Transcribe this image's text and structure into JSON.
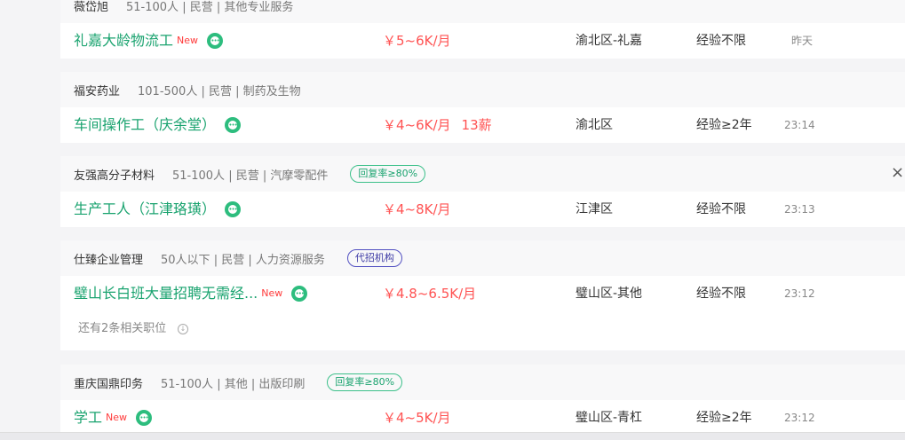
{
  "jobs": [
    {
      "company": "薇岱旭",
      "meta": "51-100人 | 民营 | 其他专业服务",
      "title": "礼嘉大龄物流工",
      "new": "New",
      "salary": "￥5~6K/月",
      "location": "渝北区-礼嘉",
      "experience": "经验不限",
      "time": "昨天"
    },
    {
      "company": "福安药业",
      "meta": "101-500人 | 民营 | 制药及生物",
      "title": "车间操作工（庆余堂）",
      "salary": "￥4~6K/月",
      "salary_extra": "13薪",
      "location": "渝北区",
      "experience": "经验≥2年",
      "time": "23:14"
    },
    {
      "company": "友强高分子材料",
      "meta": "51-100人 | 民营 | 汽摩零配件",
      "tag": "回复率≥80%",
      "title": "生产工人（江津珞璜）",
      "salary": "￥4~8K/月",
      "location": "江津区",
      "experience": "经验不限",
      "time": "23:13"
    },
    {
      "company": "仕臻企业管理",
      "meta": "50人以下 | 民营 | 人力资源服务",
      "tag": "代招机构",
      "title": "璧山长白班大量招聘无需经...",
      "new": "New",
      "salary": "￥4.8~6.5K/月",
      "location": "璧山区-其他",
      "experience": "经验不限",
      "time": "23:12",
      "more": "还有2条相关职位"
    },
    {
      "company": "重庆国鼎印务",
      "meta": "51-100人 | 其他 | 出版印刷",
      "tag": "回复率≥80%",
      "title": "学工",
      "new": "New",
      "salary": "￥4~5K/月",
      "location": "璧山区-青杠",
      "experience": "经验≥2年",
      "time": "23:12"
    }
  ],
  "close_label": "×"
}
